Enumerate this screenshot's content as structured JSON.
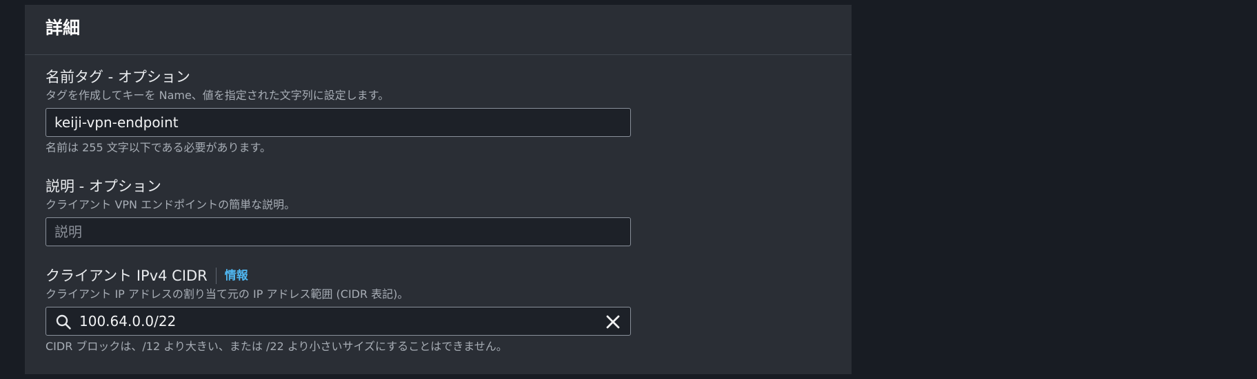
{
  "section": {
    "title": "詳細"
  },
  "name_tag": {
    "label": "名前タグ - オプション",
    "description": "タグを作成してキーを Name、値を指定された文字列に設定します。",
    "value": "keiji-vpn-endpoint",
    "constraint": "名前は 255 文字以下である必要があります。"
  },
  "description_field": {
    "label": "説明 - オプション",
    "description": "クライアント VPN エンドポイントの簡単な説明。",
    "value": "",
    "placeholder": "説明"
  },
  "client_cidr": {
    "label": "クライアント IPv4 CIDR",
    "info_link": "情報",
    "description": "クライアント IP アドレスの割り当て元の IP アドレス範囲 (CIDR 表記)。",
    "value": "100.64.0.0/22",
    "constraint": "CIDR ブロックは、/12 より大きい、または /22 より小さいサイズにすることはできません。",
    "search_icon": "search-icon",
    "clear_icon": "close-icon"
  },
  "colors": {
    "page_background": "#181c23",
    "panel_background": "#2a2e35",
    "input_background": "#1d2128",
    "input_border": "#8a919b",
    "link": "#4fb6f0"
  }
}
